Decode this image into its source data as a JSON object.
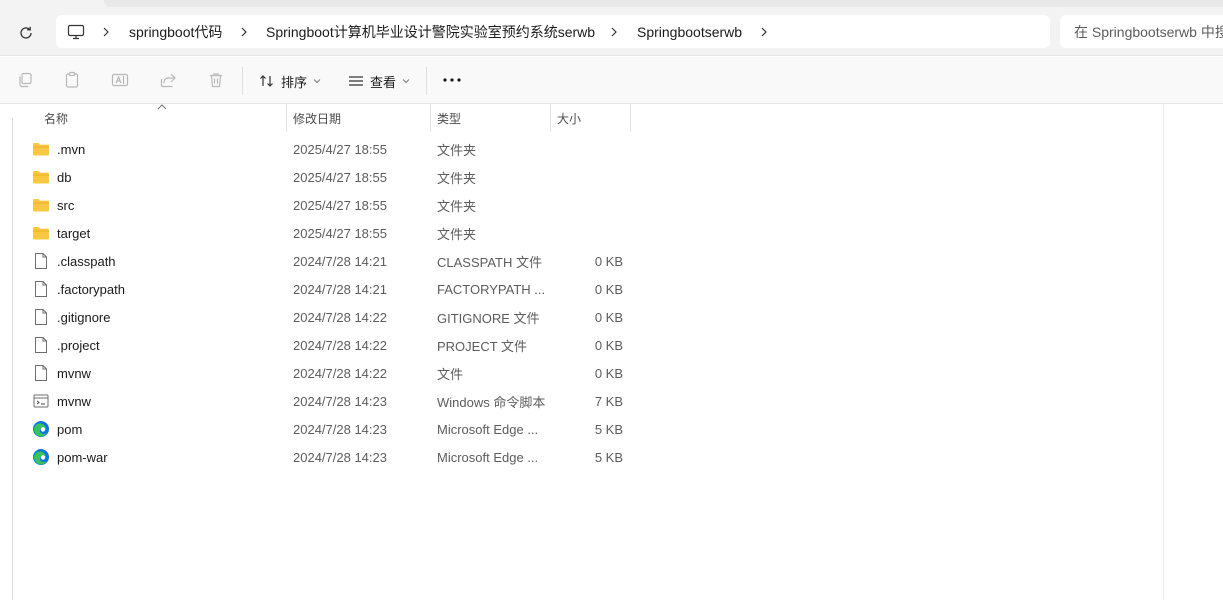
{
  "breadcrumb": {
    "items": [
      "springboot代码",
      "Springboot计算机毕业设计警院实验室预约系统serwb",
      "Springbootserwb"
    ]
  },
  "search": {
    "placeholder": "在 Springbootserwb 中搜"
  },
  "toolbar": {
    "sort_label": "排序",
    "view_label": "查看",
    "more_label": "···"
  },
  "columns": {
    "name": "名称",
    "date": "修改日期",
    "type": "类型",
    "size": "大小"
  },
  "files": [
    {
      "name": ".mvn",
      "date": "2025/4/27 18:55",
      "type": "文件夹",
      "size": "",
      "icon": "folder-icon"
    },
    {
      "name": "db",
      "date": "2025/4/27 18:55",
      "type": "文件夹",
      "size": "",
      "icon": "folder-icon"
    },
    {
      "name": "src",
      "date": "2025/4/27 18:55",
      "type": "文件夹",
      "size": "",
      "icon": "folder-icon"
    },
    {
      "name": "target",
      "date": "2025/4/27 18:55",
      "type": "文件夹",
      "size": "",
      "icon": "folder-icon"
    },
    {
      "name": ".classpath",
      "date": "2024/7/28 14:21",
      "type": "CLASSPATH 文件",
      "size": "0 KB",
      "icon": "file-icon"
    },
    {
      "name": ".factorypath",
      "date": "2024/7/28 14:21",
      "type": "FACTORYPATH ...",
      "size": "0 KB",
      "icon": "file-icon"
    },
    {
      "name": ".gitignore",
      "date": "2024/7/28 14:22",
      "type": "GITIGNORE 文件",
      "size": "0 KB",
      "icon": "file-icon"
    },
    {
      "name": ".project",
      "date": "2024/7/28 14:22",
      "type": "PROJECT 文件",
      "size": "0 KB",
      "icon": "file-icon"
    },
    {
      "name": "mvnw",
      "date": "2024/7/28 14:22",
      "type": "文件",
      "size": "0 KB",
      "icon": "file-icon"
    },
    {
      "name": "mvnw",
      "date": "2024/7/28 14:23",
      "type": "Windows 命令脚本",
      "size": "7 KB",
      "icon": "cmd-script-icon"
    },
    {
      "name": "pom",
      "date": "2024/7/28 14:23",
      "type": "Microsoft Edge ...",
      "size": "5 KB",
      "icon": "edge-icon"
    },
    {
      "name": "pom-war",
      "date": "2024/7/28 14:23",
      "type": "Microsoft Edge ...",
      "size": "5 KB",
      "icon": "edge-icon"
    }
  ],
  "colors": {
    "folder": "#f8c743",
    "edge_blue": "#0c78d4",
    "edge_green": "#3bc25c"
  }
}
